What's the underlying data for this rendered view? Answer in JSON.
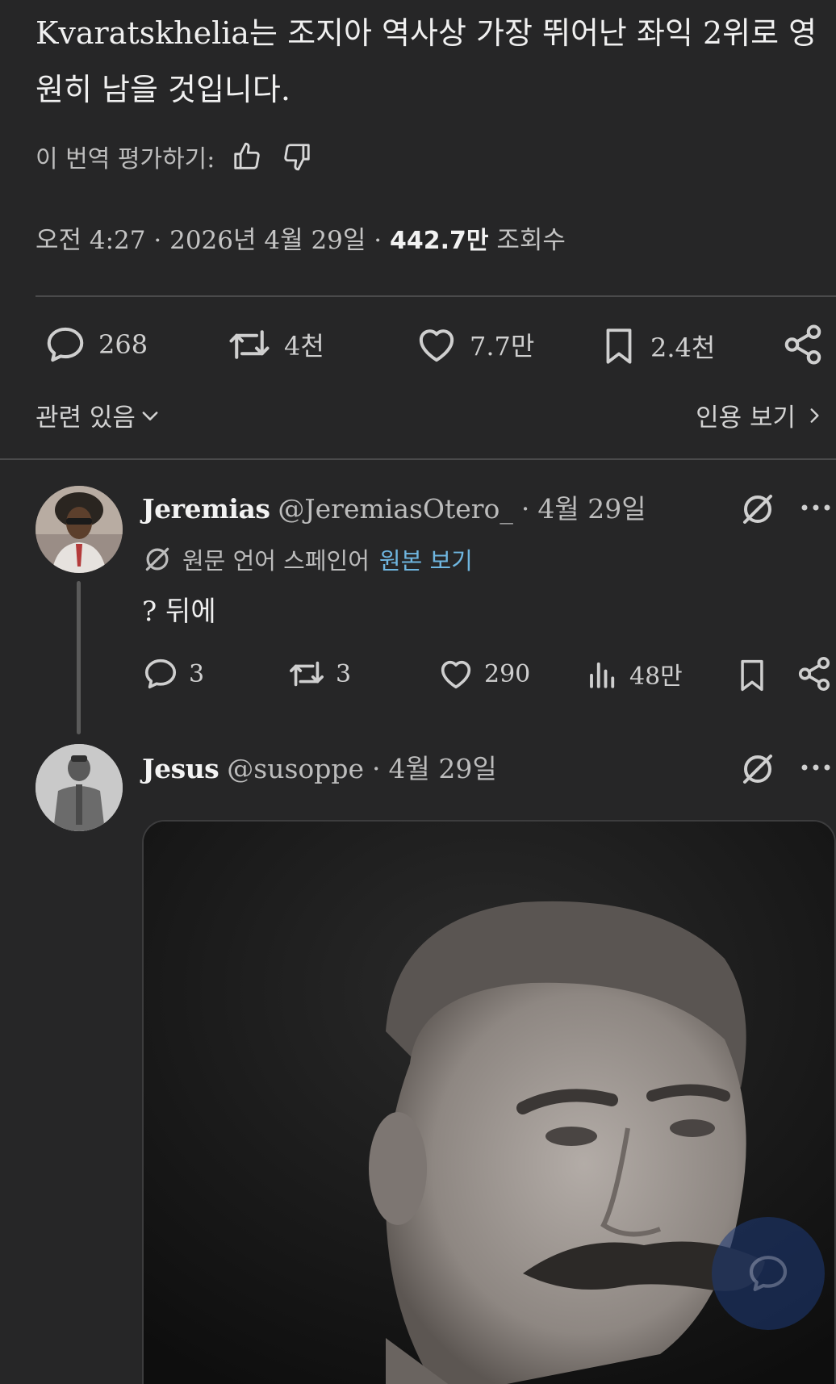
{
  "tweet": {
    "text": "Kvaratskhelia는 조지아 역사상 가장 뛰어난 좌익 2위로 영원히 남을 것입니다.",
    "rate_label": "이 번역 평가하기:",
    "time": "오전 4:27",
    "date": "2026년 4월 29일",
    "views_count": "442.7만",
    "views_label": "조회수",
    "replies": "268",
    "reposts": "4천",
    "likes": "7.7만",
    "bookmarks": "2.4천",
    "related_label": "관련 있음",
    "quotes_label": "인용 보기"
  },
  "reply1": {
    "name": "Jeremias",
    "handle": "@JeremiasOtero_",
    "date": "4월 29일",
    "lang_note": "원문 언어 스페인어",
    "original_link": "원본 보기",
    "text": "? 뒤에",
    "replies": "3",
    "reposts": "3",
    "likes": "290",
    "views": "48만"
  },
  "reply2": {
    "name": "Jesus",
    "handle": "@susoppe",
    "date": "4월 29일"
  },
  "separator": "·",
  "colors": {
    "background": "#262627",
    "link": "#6fb6e0",
    "fab": "#1d3a78"
  }
}
